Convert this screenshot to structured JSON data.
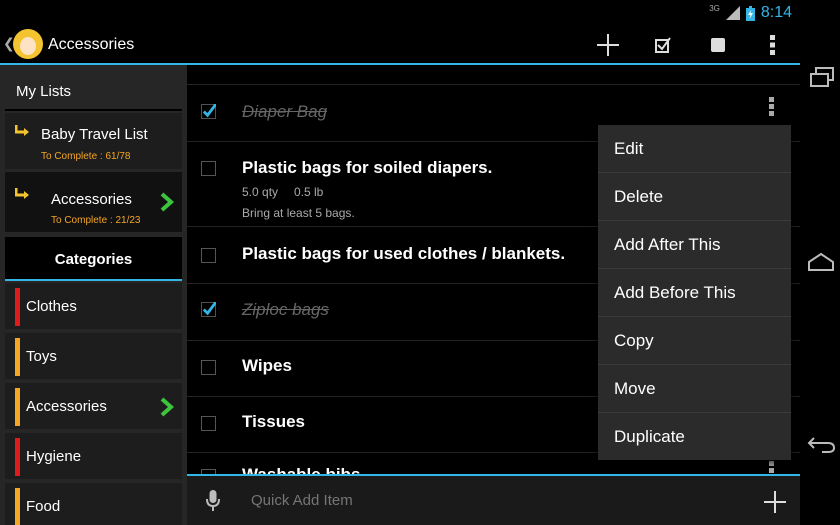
{
  "status": {
    "network": "3G",
    "time": "8:14"
  },
  "actionbar": {
    "title": "Accessories"
  },
  "sidebar": {
    "my_lists_label": "My Lists",
    "lists": [
      {
        "name": "Baby Travel List",
        "progress": "To Complete : 61/78"
      },
      {
        "name": "Accessories",
        "progress": "To Complete : 21/23"
      }
    ],
    "categories_label": "Categories",
    "categories": [
      {
        "label": "Clothes",
        "color": "#e01b1b"
      },
      {
        "label": "Toys",
        "color": "#f5a623"
      },
      {
        "label": "Accessories",
        "color": "#f5a623"
      },
      {
        "label": "Hygiene",
        "color": "#e01b1b"
      },
      {
        "label": "Food",
        "color": "#f5a623"
      }
    ]
  },
  "items": [
    {
      "title": "Diaper Bag",
      "checked": true
    },
    {
      "title": "Plastic bags for soiled diapers.",
      "checked": false,
      "qty": "5.0 qty",
      "weight": "0.5 lb",
      "note": "Bring at least 5 bags."
    },
    {
      "title": "Plastic bags for used clothes / blankets.",
      "checked": false
    },
    {
      "title": "Ziploc bags",
      "checked": true
    },
    {
      "title": "Wipes",
      "checked": false
    },
    {
      "title": "Tissues",
      "checked": false
    },
    {
      "title": "Washable bibs",
      "checked": false
    }
  ],
  "popup_menu": [
    "Edit",
    "Delete",
    "Add After This",
    "Add Before This",
    "Copy",
    "Move",
    "Duplicate"
  ],
  "quick_add": {
    "placeholder": "Quick Add Item"
  },
  "colors": {
    "accent": "#33b5e5",
    "checkmark": "#33b5e5",
    "chevron": "#3cc43c",
    "progress": "#f5a623"
  }
}
